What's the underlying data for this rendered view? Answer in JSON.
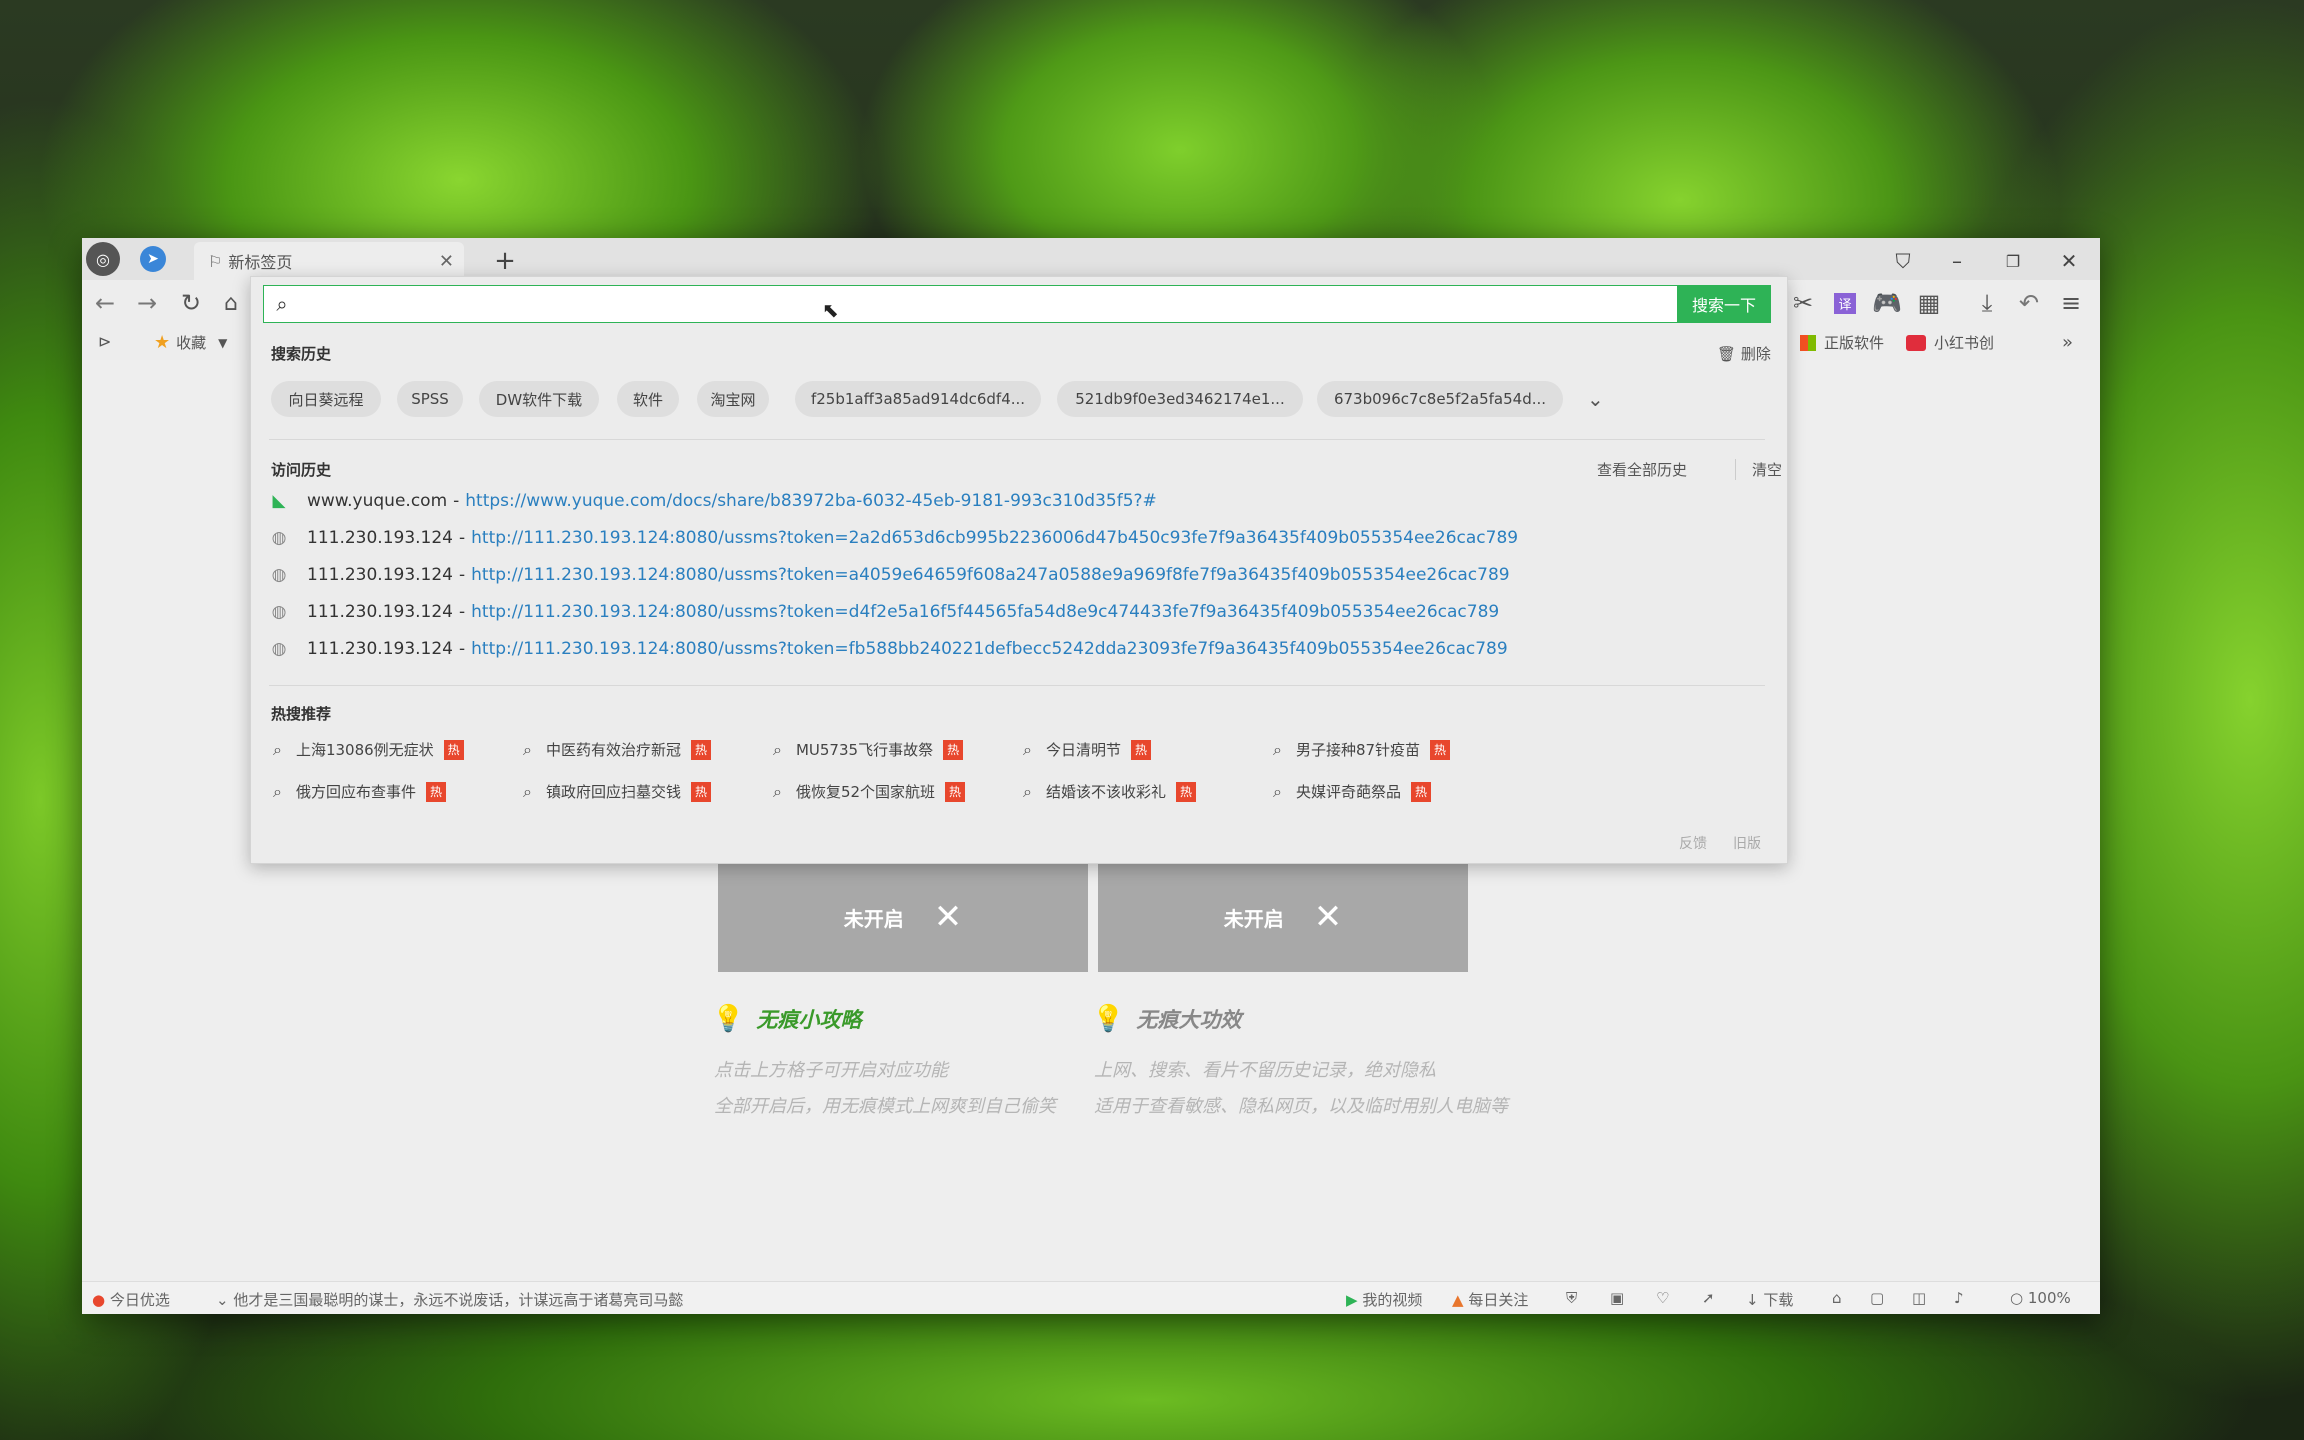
{
  "tab": {
    "title": "新标签页"
  },
  "bookmarks": {
    "favorites_label": "收藏",
    "items": [
      {
        "label": "正版软件"
      },
      {
        "label": "小红书创"
      }
    ]
  },
  "search": {
    "value": "",
    "placeholder": "",
    "button_label": "搜索一下"
  },
  "search_history": {
    "title": "搜索历史",
    "delete_label": "删除",
    "chips": [
      "向日葵远程",
      "SPSS",
      "DW软件下载",
      "软件",
      "淘宝网",
      "f25b1aff3a85ad914dc6df4...",
      "521db9f0e3ed3462174e1...",
      "673b096c7c8e5f2a5fa54d..."
    ]
  },
  "visit_history": {
    "title": "访问历史",
    "view_all_label": "查看全部历史",
    "clear_label": "清空",
    "rows": [
      {
        "host": "www.yuque.com",
        "url": "https://www.yuque.com/docs/share/b83972ba-6032-45eb-9181-993c310d35f5?#"
      },
      {
        "host": "111.230.193.124",
        "url": "http://111.230.193.124:8080/ussms?token=2a2d653d6cb995b2236006d47b450c93fe7f9a36435f409b055354ee26cac789"
      },
      {
        "host": "111.230.193.124",
        "url": "http://111.230.193.124:8080/ussms?token=a4059e64659f608a247a0588e9a969f8fe7f9a36435f409b055354ee26cac789"
      },
      {
        "host": "111.230.193.124",
        "url": "http://111.230.193.124:8080/ussms?token=d4f2e5a16f5f44565fa54d8e9c474433fe7f9a36435f409b055354ee26cac789"
      },
      {
        "host": "111.230.193.124",
        "url": "http://111.230.193.124:8080/ussms?token=fb588bb240221defbecc5242dda23093fe7f9a36435f409b055354ee26cac789"
      }
    ]
  },
  "hot_search": {
    "title": "热搜推荐",
    "badge": "热",
    "items": [
      "上海13086例无症状",
      "中医药有效治疗新冠",
      "MU5735飞行事故祭",
      "今日清明节",
      "男子接种87针疫苗",
      "俄方回应布查事件",
      "镇政府回应扫墓交钱",
      "俄恢复52个国家航班",
      "结婚该不该收彩礼",
      "央媒评奇葩祭品"
    ]
  },
  "footer": {
    "feedback_label": "反馈",
    "old_label": "旧版"
  },
  "incognito": {
    "cards": [
      {
        "label": "未开启"
      },
      {
        "label": "未开启"
      }
    ],
    "tips": [
      {
        "title": "无痕小攻略",
        "lines": [
          "点击上方格子可开启对应功能",
          "全部开启后，用无痕模式上网爽到自己偷笑"
        ]
      },
      {
        "title": "无痕大功效",
        "lines": [
          "上网、搜索、看片不留历史记录，绝对隐私",
          "适用于查看敏感、隐私网页，以及临时用别人电脑等"
        ]
      }
    ]
  },
  "statusbar": {
    "today_label": "今日优选",
    "news": "他才是三国最聪明的谋士，永远不说废话，计谋远高于诸葛亮司马懿",
    "video_label": "我的视频",
    "daily_label": "每日关注",
    "download_label": "下载",
    "zoom": "100%"
  },
  "colors": {
    "accent": "#2eb356",
    "link": "#2a7fbf",
    "hot_badge": "#e8472d"
  }
}
